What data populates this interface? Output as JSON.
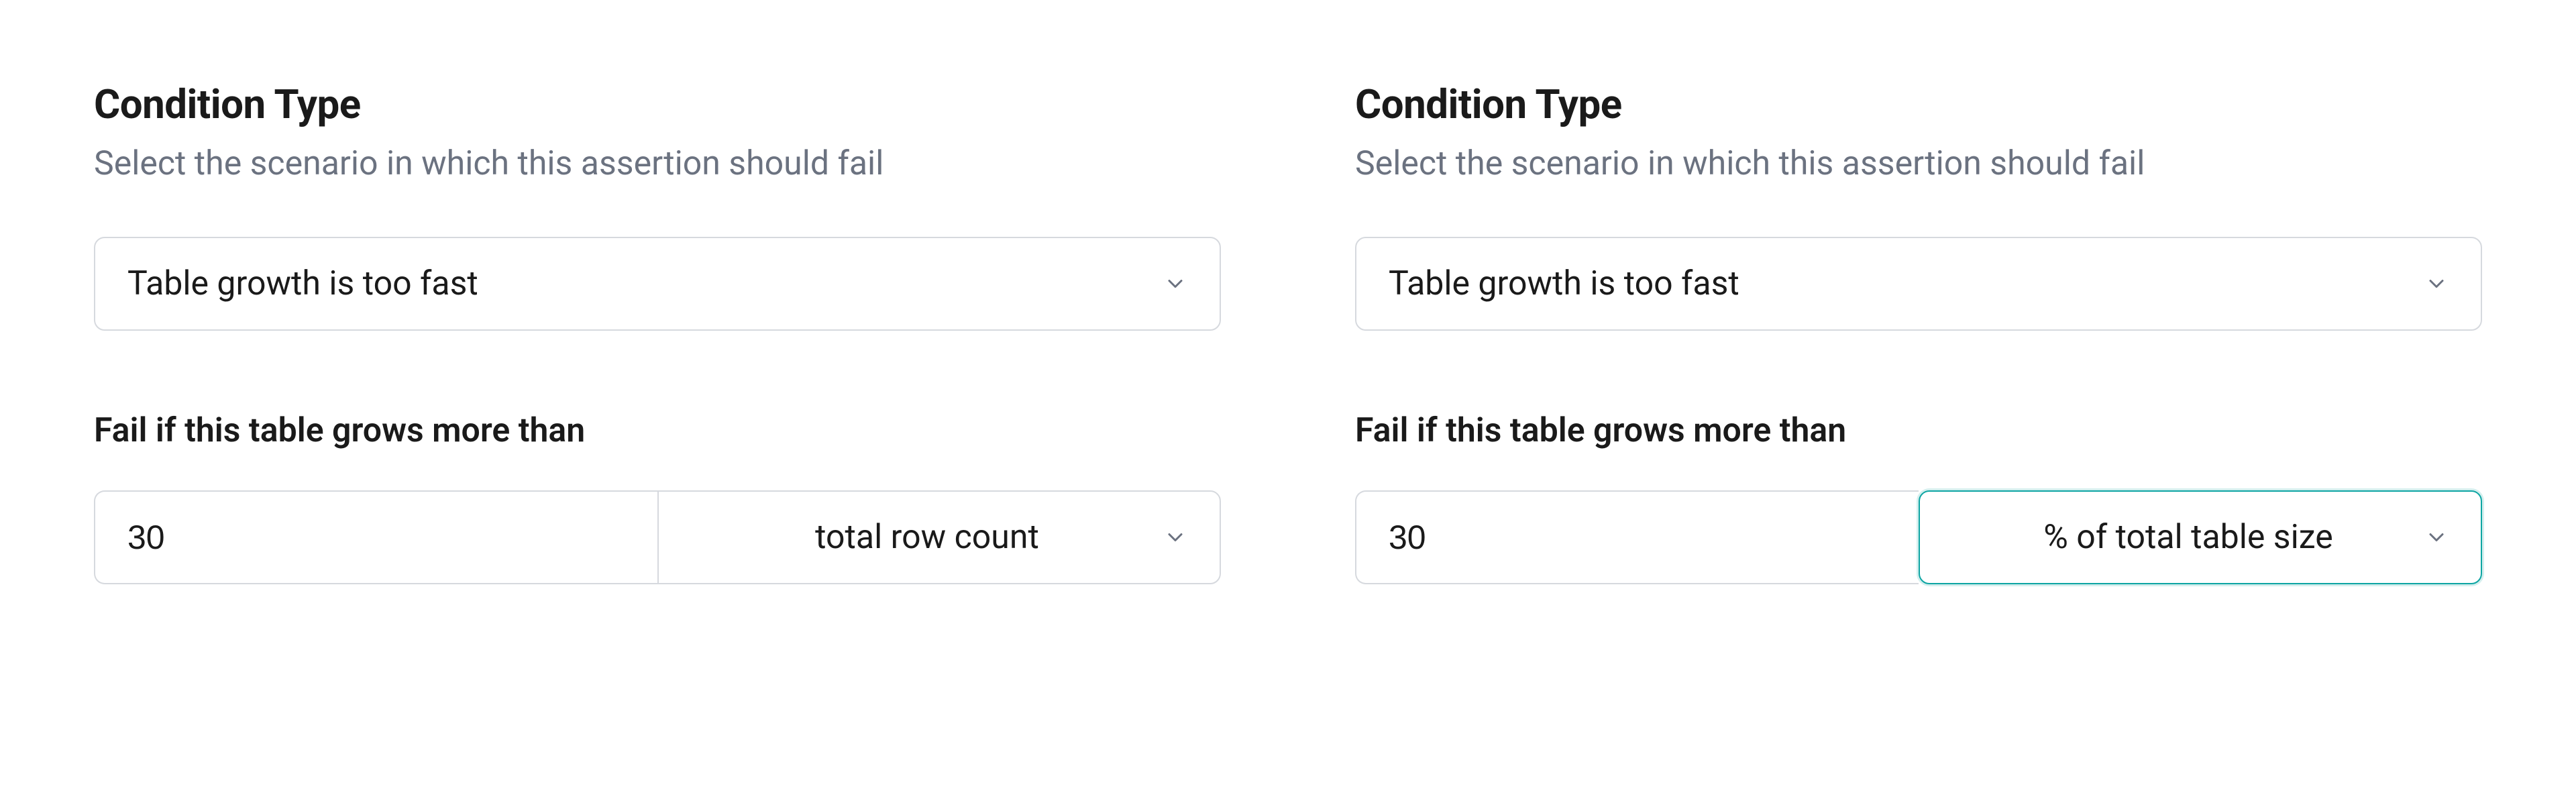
{
  "panels": [
    {
      "condition_type": {
        "title": "Condition Type",
        "description": "Select the scenario in which this assertion should fail",
        "selected": "Table growth is too fast"
      },
      "threshold": {
        "label": "Fail if this table grows more than",
        "value": "30",
        "unit_selected": "total row count",
        "unit_focused": false
      }
    },
    {
      "condition_type": {
        "title": "Condition Type",
        "description": "Select the scenario in which this assertion should fail",
        "selected": "Table growth is too fast"
      },
      "threshold": {
        "label": "Fail if this table grows more than",
        "value": "30",
        "unit_selected": "% of total table size",
        "unit_focused": true
      }
    }
  ]
}
